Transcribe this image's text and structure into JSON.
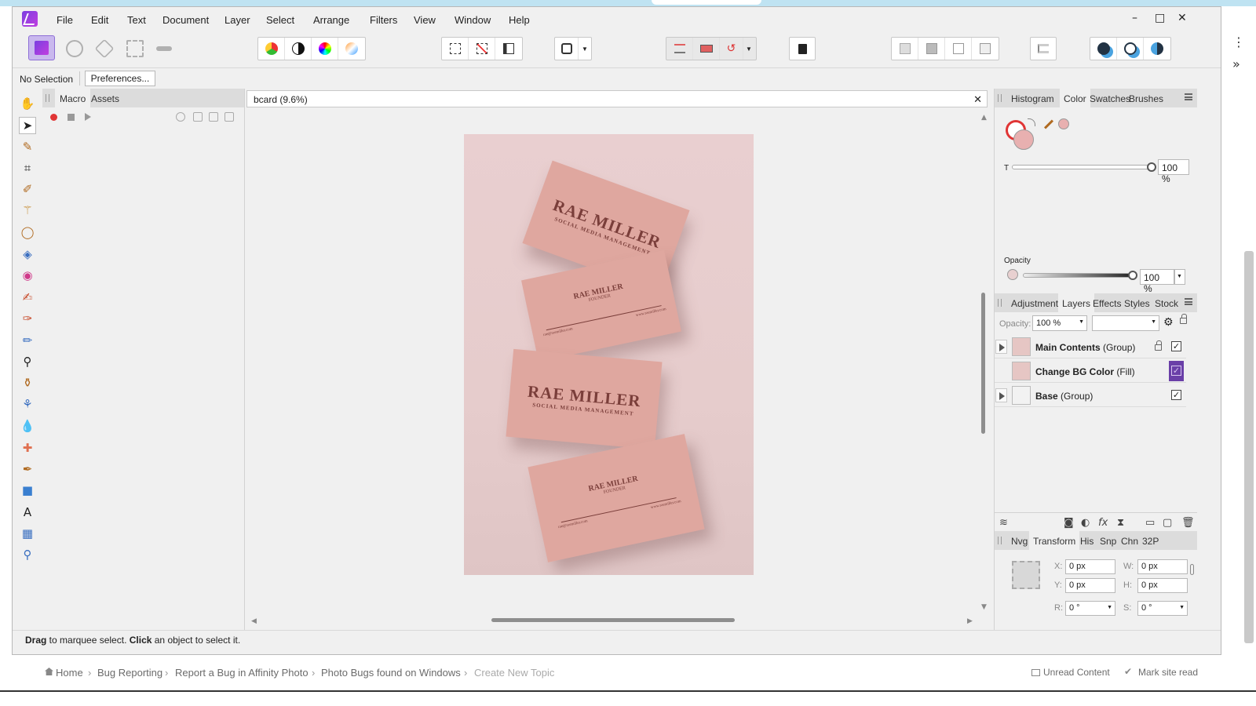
{
  "menu": {
    "items": [
      "File",
      "Edit",
      "Text",
      "Document",
      "Layer",
      "Select",
      "Arrange",
      "Filters",
      "View",
      "Window",
      "Help"
    ],
    "window_controls": [
      "–",
      "□",
      "✕"
    ]
  },
  "context": {
    "selection": "No Selection",
    "preferences": "Preferences..."
  },
  "left_panel": {
    "tabs": [
      "Macro",
      "Assets"
    ]
  },
  "document": {
    "tab_title": "bcard (9.6%)",
    "close": "✕",
    "cards": {
      "name": "RAE MILLER",
      "tagline": "SOCIAL MEDIA MANAGEMENT",
      "role": "FOUNDER",
      "email": "rae@raemiller.com",
      "website": "www.raemiller.com"
    }
  },
  "color_panel": {
    "tabs": [
      "Histogram",
      "Color",
      "Swatches",
      "Brushes"
    ],
    "active_tab": "Color",
    "tint_label": "T",
    "tint_value": "100 %",
    "opacity_label": "Opacity",
    "opacity_value": "100 %",
    "fill_color": "#e8b0b0",
    "stroke_color": "#e03535"
  },
  "layers_panel": {
    "tabs": [
      "Adjustment",
      "Layers",
      "Effects",
      "Styles",
      "Stock"
    ],
    "active_tab": "Layers",
    "opacity_label": "Opacity:",
    "opacity_value": "100 %",
    "blend_mode": "",
    "layers": [
      {
        "name": "Main Contents",
        "kind": "(Group)",
        "visible": true,
        "locked": true
      },
      {
        "name": "Change BG Color",
        "kind": "(Fill)",
        "visible": true,
        "locked": false
      },
      {
        "name": "Base",
        "kind": "(Group)",
        "visible": true,
        "locked": false
      }
    ]
  },
  "transform_panel": {
    "tabs": [
      "Nvg",
      "Transform",
      "His",
      "Snp",
      "Chn",
      "32P"
    ],
    "active_tab": "Transform",
    "x_label": "X:",
    "x_value": "0 px",
    "y_label": "Y:",
    "y_value": "0 px",
    "w_label": "W:",
    "w_value": "0 px",
    "h_label": "H:",
    "h_value": "0 px",
    "r_label": "R:",
    "r_value": "0 °",
    "s_label": "S:",
    "s_value": "0 °"
  },
  "status": {
    "drag": "Drag",
    "drag_text": " to marquee select. ",
    "click": "Click",
    "click_text": " an object to select it."
  },
  "forum": {
    "breadcrumbs": [
      "Home",
      "Bug Reporting",
      "Report a Bug in Affinity Photo",
      "Photo Bugs found on Windows",
      "Create New Topic"
    ],
    "sep": "›",
    "unread": "Unread Content",
    "mark_read": "Mark site read"
  },
  "sidebar_controls": {
    "more": "⋮",
    "expand": "»"
  },
  "colors": {
    "accent": "#7b3fe0",
    "card": "#dfa79f",
    "card_text": "#7a3e3a"
  }
}
